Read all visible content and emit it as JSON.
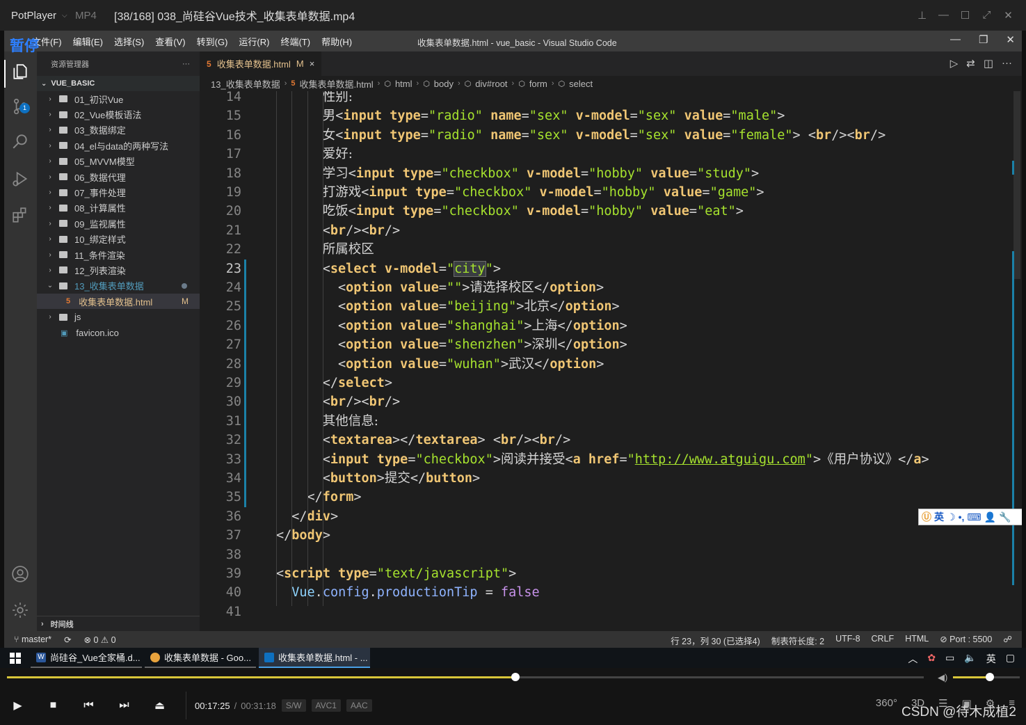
{
  "potplayer": {
    "app_name": "PotPlayer",
    "format": "MP4",
    "title": "[38/168] 038_尚硅谷Vue技术_收集表单数据.mp4",
    "pause_overlay": "暂停",
    "current_time": "00:17:25",
    "separator": "/",
    "duration": "00:31:18",
    "tags": [
      "S/W",
      "AVC1",
      "AAC"
    ],
    "seek_progress": 0.555,
    "volume": 0.55,
    "right_icons": [
      "360°",
      "3D"
    ]
  },
  "vscode": {
    "menus": [
      "文件(F)",
      "编辑(E)",
      "选择(S)",
      "查看(V)",
      "转到(G)",
      "运行(R)",
      "终端(T)",
      "帮助(H)"
    ],
    "window_title": "收集表单数据.html - vue_basic - Visual Studio Code",
    "explorer": {
      "header": "资源管理器",
      "more": "···",
      "folder": "VUE_BASIC",
      "items": [
        {
          "label": "01_初识Vue",
          "type": "folder"
        },
        {
          "label": "02_Vue模板语法",
          "type": "folder"
        },
        {
          "label": "03_数据绑定",
          "type": "folder"
        },
        {
          "label": "04_el与data的两种写法",
          "type": "folder"
        },
        {
          "label": "05_MVVM模型",
          "type": "folder"
        },
        {
          "label": "06_数据代理",
          "type": "folder"
        },
        {
          "label": "07_事件处理",
          "type": "folder"
        },
        {
          "label": "08_计算属性",
          "type": "folder"
        },
        {
          "label": "09_监视属性",
          "type": "folder"
        },
        {
          "label": "10_绑定样式",
          "type": "folder"
        },
        {
          "label": "11_条件渲染",
          "type": "folder"
        },
        {
          "label": "12_列表渲染",
          "type": "folder"
        },
        {
          "label": "13_收集表单数据",
          "type": "open-folder"
        },
        {
          "label": "收集表单数据.html",
          "type": "file",
          "flag": "M"
        },
        {
          "label": "js",
          "type": "folder"
        },
        {
          "label": "favicon.ico",
          "type": "ico"
        }
      ],
      "timeline": "时间线",
      "badge": "1"
    },
    "tab": {
      "label": "收集表单数据.html",
      "flag": "M",
      "close": "×"
    },
    "breadcrumb": [
      "13_收集表单数据",
      "收集表单数据.html",
      "html",
      "body",
      "div#root",
      "form",
      "select"
    ],
    "code_lines": [
      {
        "n": "14",
        "html": "<span class='t-cn'>性别:</span>",
        "indent": 8
      },
      {
        "n": "15",
        "html": "<span class='t-cn'>男</span><span class='t-br'>&lt;</span><span class='t-tag'>input</span> <span class='t-attr'>type</span>=<span class='t-str'>\"radio\"</span> <span class='t-attr'>name</span>=<span class='t-str'>\"sex\"</span> <span class='t-attr'>v-model</span>=<span class='t-str'>\"sex\"</span> <span class='t-attr'>value</span>=<span class='t-str'>\"male\"</span><span class='t-br'>&gt;</span>",
        "indent": 8
      },
      {
        "n": "16",
        "html": "<span class='t-cn'>女</span><span class='t-br'>&lt;</span><span class='t-tag'>input</span> <span class='t-attr'>type</span>=<span class='t-str'>\"radio\"</span> <span class='t-attr'>name</span>=<span class='t-str'>\"sex\"</span> <span class='t-attr'>v-model</span>=<span class='t-str'>\"sex\"</span> <span class='t-attr'>value</span>=<span class='t-str'>\"female\"</span><span class='t-br'>&gt;</span> <span class='t-br'>&lt;</span><span class='t-tag'>br</span><span class='t-br'>/&gt;&lt;</span><span class='t-tag'>br</span><span class='t-br'>/&gt;</span>",
        "indent": 8
      },
      {
        "n": "17",
        "html": "<span class='t-cn'>爱好:</span>",
        "indent": 8
      },
      {
        "n": "18",
        "html": "<span class='t-cn'>学习</span><span class='t-br'>&lt;</span><span class='t-tag'>input</span> <span class='t-attr'>type</span>=<span class='t-str'>\"checkbox\"</span> <span class='t-attr'>v-model</span>=<span class='t-str'>\"hobby\"</span> <span class='t-attr'>value</span>=<span class='t-str'>\"study\"</span><span class='t-br'>&gt;</span>",
        "indent": 8
      },
      {
        "n": "19",
        "html": "<span class='t-cn'>打游戏</span><span class='t-br'>&lt;</span><span class='t-tag'>input</span> <span class='t-attr'>type</span>=<span class='t-str'>\"checkbox\"</span> <span class='t-attr'>v-model</span>=<span class='t-str'>\"hobby\"</span> <span class='t-attr'>value</span>=<span class='t-str'>\"game\"</span><span class='t-br'>&gt;</span>",
        "indent": 8
      },
      {
        "n": "20",
        "html": "<span class='t-cn'>吃饭</span><span class='t-br'>&lt;</span><span class='t-tag'>input</span> <span class='t-attr'>type</span>=<span class='t-str'>\"checkbox\"</span> <span class='t-attr'>v-model</span>=<span class='t-str'>\"hobby\"</span> <span class='t-attr'>value</span>=<span class='t-str'>\"eat\"</span><span class='t-br'>&gt;</span>",
        "indent": 8
      },
      {
        "n": "21",
        "html": "<span class='t-br'>&lt;</span><span class='t-tag'>br</span><span class='t-br'>/&gt;&lt;</span><span class='t-tag'>br</span><span class='t-br'>/&gt;</span>",
        "indent": 8
      },
      {
        "n": "22",
        "html": "<span class='t-cn'>所属校区</span>",
        "indent": 8
      },
      {
        "n": "23",
        "html": "<span class='t-br'>&lt;</span><span class='t-tag'>select</span> <span class='t-attr'>v-model</span>=<span class='t-str'>\"<span class='sel'>city</span>\"</span><span class='t-br'>&gt;</span>",
        "indent": 8,
        "current": true
      },
      {
        "n": "24",
        "html": "<span class='t-br'>&lt;</span><span class='t-tag'>option</span> <span class='t-attr'>value</span>=<span class='t-str'>\"\"</span><span class='t-br'>&gt;</span><span class='t-cn'>请选择校区</span><span class='t-br'>&lt;/</span><span class='t-tag'>option</span><span class='t-br'>&gt;</span>",
        "indent": 10
      },
      {
        "n": "25",
        "html": "<span class='t-br'>&lt;</span><span class='t-tag'>option</span> <span class='t-attr'>value</span>=<span class='t-str'>\"beijing\"</span><span class='t-br'>&gt;</span><span class='t-cn'>北京</span><span class='t-br'>&lt;/</span><span class='t-tag'>option</span><span class='t-br'>&gt;</span>",
        "indent": 10
      },
      {
        "n": "26",
        "html": "<span class='t-br'>&lt;</span><span class='t-tag'>option</span> <span class='t-attr'>value</span>=<span class='t-str'>\"shanghai\"</span><span class='t-br'>&gt;</span><span class='t-cn'>上海</span><span class='t-br'>&lt;/</span><span class='t-tag'>option</span><span class='t-br'>&gt;</span>",
        "indent": 10
      },
      {
        "n": "27",
        "html": "<span class='t-br'>&lt;</span><span class='t-tag'>option</span> <span class='t-attr'>value</span>=<span class='t-str'>\"shenzhen\"</span><span class='t-br'>&gt;</span><span class='t-cn'>深圳</span><span class='t-br'>&lt;/</span><span class='t-tag'>option</span><span class='t-br'>&gt;</span>",
        "indent": 10
      },
      {
        "n": "28",
        "html": "<span class='t-br'>&lt;</span><span class='t-tag'>option</span> <span class='t-attr'>value</span>=<span class='t-str'>\"wuhan\"</span><span class='t-br'>&gt;</span><span class='t-cn'>武汉</span><span class='t-br'>&lt;/</span><span class='t-tag'>option</span><span class='t-br'>&gt;</span>",
        "indent": 10
      },
      {
        "n": "29",
        "html": "<span class='t-br'>&lt;/</span><span class='t-tag'>select</span><span class='t-br'>&gt;</span>",
        "indent": 8
      },
      {
        "n": "30",
        "html": "<span class='t-br'>&lt;</span><span class='t-tag'>br</span><span class='t-br'>/&gt;&lt;</span><span class='t-tag'>br</span><span class='t-br'>/&gt;</span>",
        "indent": 8
      },
      {
        "n": "31",
        "html": "<span class='t-cn'>其他信息:</span>",
        "indent": 8
      },
      {
        "n": "32",
        "html": "<span class='t-br'>&lt;</span><span class='t-tag'>textarea</span><span class='t-br'>&gt;&lt;/</span><span class='t-tag'>textarea</span><span class='t-br'>&gt;</span> <span class='t-br'>&lt;</span><span class='t-tag'>br</span><span class='t-br'>/&gt;&lt;</span><span class='t-tag'>br</span><span class='t-br'>/&gt;</span>",
        "indent": 8
      },
      {
        "n": "33",
        "html": "<span class='t-br'>&lt;</span><span class='t-tag'>input</span> <span class='t-attr'>type</span>=<span class='t-str'>\"checkbox\"</span><span class='t-br'>&gt;</span><span class='t-cn'>阅读并接受</span><span class='t-br'>&lt;</span><span class='t-tag'>a</span> <span class='t-attr'>href</span>=<span class='t-str'>\"</span><span class='t-url'>http://www.atguigu.com</span><span class='t-str'>\"</span><span class='t-br'>&gt;</span><span class='t-cn'>《用户协议》</span><span class='t-br'>&lt;/</span><span class='t-tag'>a</span><span class='t-br'>&gt;</span>",
        "indent": 8
      },
      {
        "n": "34",
        "html": "<span class='t-br'>&lt;</span><span class='t-tag'>button</span><span class='t-br'>&gt;</span><span class='t-cn'>提交</span><span class='t-br'>&lt;/</span><span class='t-tag'>button</span><span class='t-br'>&gt;</span>",
        "indent": 8
      },
      {
        "n": "35",
        "html": "<span class='t-br'>&lt;/</span><span class='t-tag'>form</span><span class='t-br'>&gt;</span>",
        "indent": 6
      },
      {
        "n": "36",
        "html": "<span class='t-br'>&lt;/</span><span class='t-tag'>div</span><span class='t-br'>&gt;</span>",
        "indent": 4
      },
      {
        "n": "37",
        "html": "<span class='t-br'>&lt;/</span><span class='t-tag'>body</span><span class='t-br'>&gt;</span>",
        "indent": 2
      },
      {
        "n": "38",
        "html": "",
        "indent": 0
      },
      {
        "n": "39",
        "html": "<span class='t-br'>&lt;</span><span class='t-tag'>script</span> <span class='t-attr'>type</span>=<span class='t-str'>\"text/javascript\"</span><span class='t-br'>&gt;</span>",
        "indent": 2
      },
      {
        "n": "40",
        "html": "<span class='t-js'>Vue</span>.<span class='t-kw'>config</span>.<span class='t-kw'>productionTip</span> = <span class='t-bool'>false</span>",
        "indent": 4
      },
      {
        "n": "41",
        "html": "",
        "indent": 0
      }
    ],
    "ime_bar": "英",
    "status": {
      "branch": "master*",
      "problems": "⊗ 0 ⚠ 0",
      "position": "行 23，列 30 (已选择4)",
      "tab_size": "制表符长度: 2",
      "encoding": "UTF-8",
      "eol": "CRLF",
      "language": "HTML",
      "port": "⊘ Port : 5500"
    }
  },
  "taskbar": {
    "apps": [
      {
        "label": "尚硅谷_Vue全家桶.d...",
        "color": "#2b579a",
        "letter": "W"
      },
      {
        "label": "收集表单数据 - Goo...",
        "color": "#e8a33d",
        "letter": ""
      },
      {
        "label": "收集表单数据.html - ...",
        "color": "#0e70c0",
        "letter": ""
      }
    ],
    "ime": "英"
  },
  "watermark": "CSDN @待木成植2"
}
